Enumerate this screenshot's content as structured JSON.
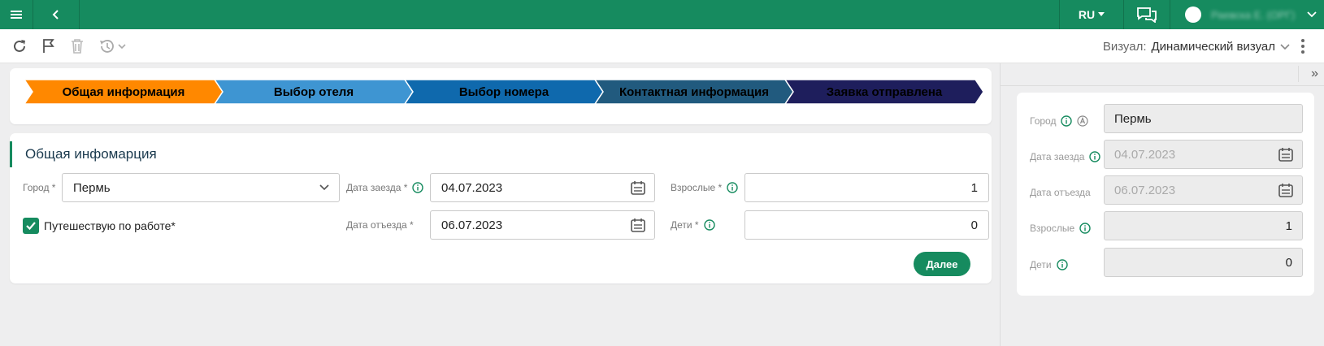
{
  "header": {
    "language": "RU",
    "user_name": "Раевска Е. (ОРГ)"
  },
  "toolbar": {
    "visual_label": "Визуал:",
    "visual_value": "Динамический визуал"
  },
  "steps": [
    {
      "label": "Общая информация",
      "color": "#ff8800"
    },
    {
      "label": "Выбор отеля",
      "color": "#3e95d2"
    },
    {
      "label": "Выбор номера",
      "color": "#0f69ad"
    },
    {
      "label": "Контактная информация",
      "color": "#215a7e"
    },
    {
      "label": "Заявка отправлена",
      "color": "#1e1e5c"
    }
  ],
  "form": {
    "title": "Общая инфомарция",
    "city_label": "Город *",
    "city_value": "Пермь",
    "business_trip_label": "Путешествую по работе*",
    "checkin_label": "Дата заезда *",
    "checkin_value": "04.07.2023",
    "checkout_label": "Дата отъезда *",
    "checkout_value": "06.07.2023",
    "adults_label": "Взрослые *",
    "adults_value": "1",
    "children_label": "Дети *",
    "children_value": "0",
    "next_button": "Далее"
  },
  "right_panel": {
    "city_label": "Город",
    "city_value": "Пермь",
    "checkin_label": "Дата заезда",
    "checkin_value": "04.07.2023",
    "checkout_label": "Дата отъезда",
    "checkout_value": "06.07.2023",
    "adults_label": "Взрослые",
    "adults_value": "1",
    "children_label": "Дети",
    "children_value": "0",
    "expand_glyph": "»"
  },
  "colors": {
    "brand": "#168b5f",
    "step_active": "#ff8800"
  }
}
